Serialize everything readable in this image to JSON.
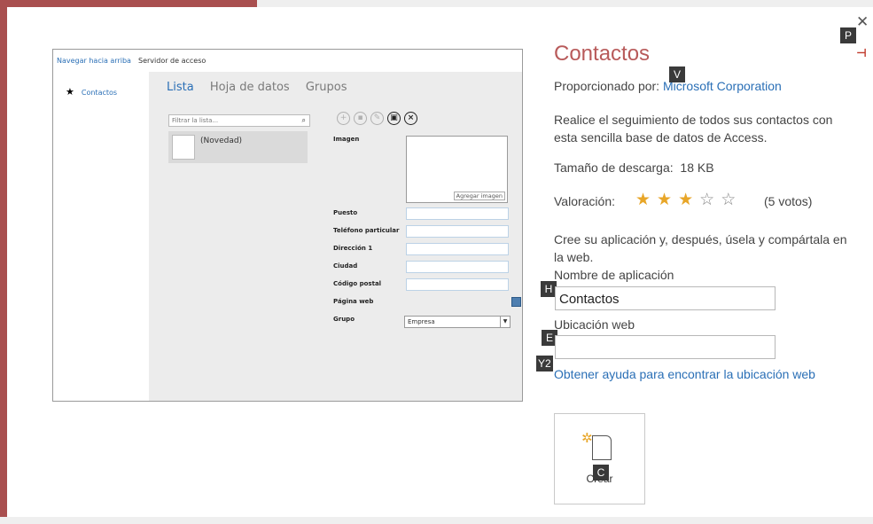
{
  "preview": {
    "nav_up": "Navegar hacia arriba",
    "server": "Servidor de acceso",
    "left_item": "Contactos",
    "tabs": [
      "Lista",
      "Hoja de datos",
      "Grupos"
    ],
    "filter_placeholder": "Filtrar la lista...",
    "list_item": "(Novedad)",
    "image_label": "Imagen",
    "add_image": "Agregar imagen",
    "labels": [
      "Puesto",
      "Teléfono particular",
      "Dirección 1",
      "Ciudad",
      "Código postal",
      "Página web",
      "Grupo"
    ],
    "group_value": "Empresa"
  },
  "panel": {
    "title": "Contactos",
    "provided_by_label": "Proporcionado por:",
    "provider": "Microsoft Corporation",
    "description": "Realice el seguimiento de todos sus contactos con esta sencilla base de datos de Access.",
    "download_size_label": "Tamaño de descarga:",
    "download_size": "18 KB",
    "rating_label": "Valoración:",
    "rating_value": 3,
    "rating_max": 5,
    "votes": "(5 votos)",
    "create_hint": "Cree su aplicación y, después, úsela y compártala en la web.",
    "app_name_label": "Nombre de aplicación",
    "app_name_value": "Contactos",
    "web_location_label": "Ubicación web",
    "web_location_value": "",
    "help_link": "Obtener ayuda para encontrar la ubicación web",
    "create_label": "Crear"
  },
  "keytips": {
    "pin": "P",
    "provider": "V",
    "app_name": "H",
    "web_location": "E",
    "help": "Y2",
    "create": "C"
  },
  "colors": {
    "accent_title": "#b85a5a",
    "link": "#2a6fb6",
    "star": "#e8a628"
  },
  "icons": [
    "close-icon",
    "pin-icon",
    "star-icon",
    "new-document-icon",
    "search-icon"
  ]
}
